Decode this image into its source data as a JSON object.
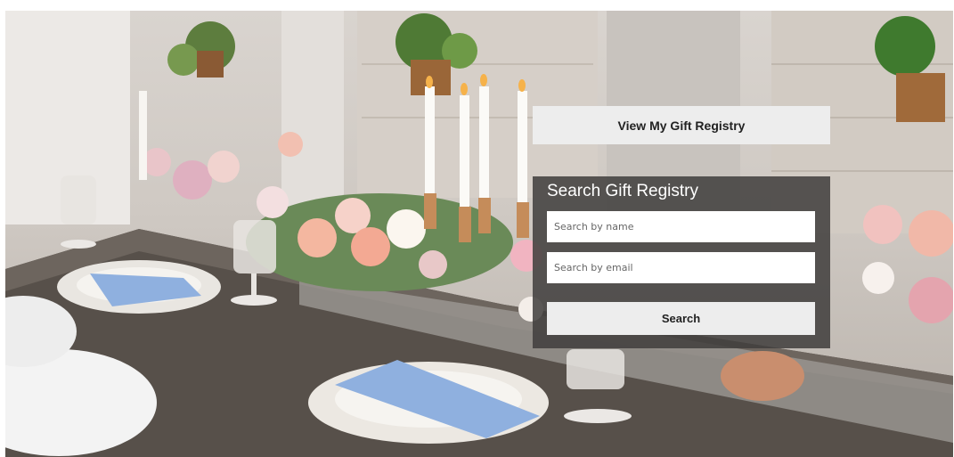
{
  "registry": {
    "view_label": "View My Gift Registry",
    "search_title": "Search Gift Registry",
    "name_placeholder": "Search by name",
    "email_placeholder": "Search by email",
    "search_label": "Search"
  },
  "colors": {
    "panel_bg": "#403e3d",
    "button_bg": "#ededed",
    "table_wood": "#55504c",
    "wall": "#d9d4cf"
  }
}
